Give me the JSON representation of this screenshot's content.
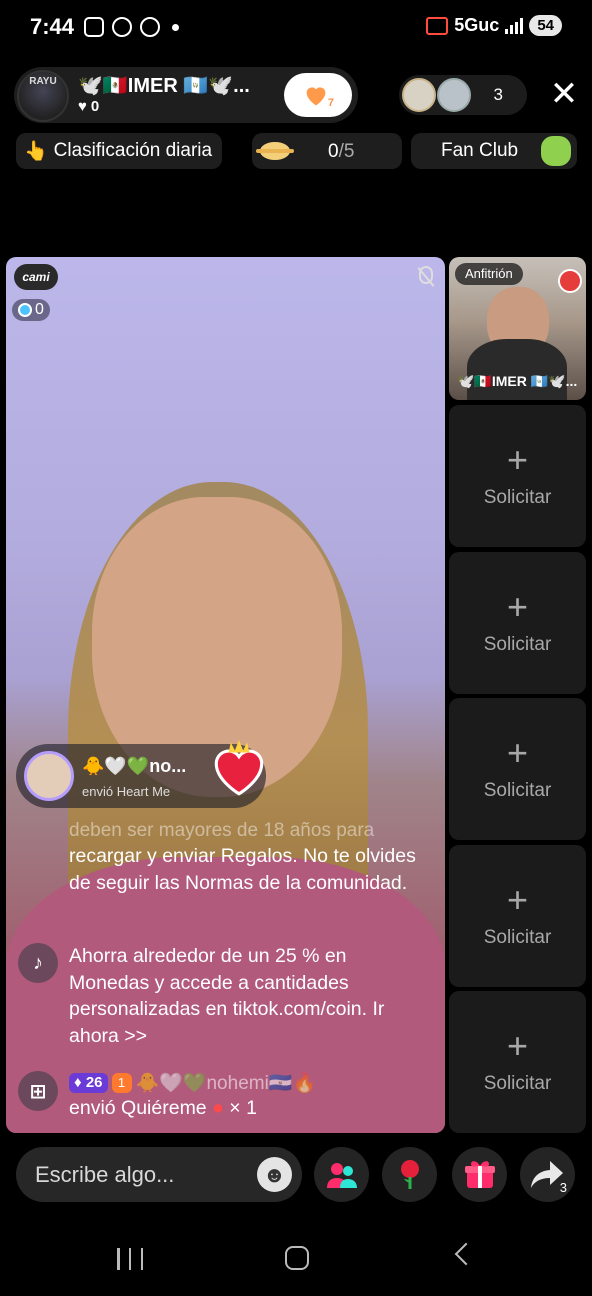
{
  "status_bar": {
    "time": "7:44",
    "network": "5Guc",
    "battery": "54"
  },
  "host": {
    "avatar_text": "RAYU",
    "name": "🕊️🇲🇽IMER 🇬🇹🕊️...",
    "likes": "0",
    "follow_count": "7"
  },
  "viewers": {
    "count": "3"
  },
  "badges": {
    "ranking": "Clasificación diaria",
    "planet_current": "0",
    "planet_total": "/5",
    "fan_club": "Fan Club"
  },
  "guest": {
    "badge": "cami",
    "score": "0"
  },
  "gift_toast": {
    "name": "🐥🤍💚no...",
    "message": "envió Heart Me"
  },
  "chat": {
    "faded_line": "deben ser mayores de 18 años para",
    "notice": "recargar y enviar Regalos. No te olvides de seguir las Normas de la comunidad.",
    "promo": "Ahorra alrededor de un 25 % en Monedas y accede a cantidades personalizadas en tiktok.com/coin. Ir ahora >>",
    "gift_user_level": "26",
    "gift_user_fan_level": "1",
    "gift_user_name": "🐥🤍💚nohemi🇸🇻🔥",
    "gift_message": "envió Quiéreme",
    "gift_count": "× 1"
  },
  "side_panel": {
    "host_label": "Anfitrión",
    "host_name": "🕊️🇲🇽IMER 🇬🇹🕊️...",
    "slots": [
      {
        "label": "Solicitar"
      },
      {
        "label": "Solicitar"
      },
      {
        "label": "Solicitar"
      },
      {
        "label": "Solicitar"
      },
      {
        "label": "Solicitar"
      }
    ]
  },
  "bottom_bar": {
    "input_placeholder": "Escribe algo...",
    "share_count": "3"
  },
  "icons": {
    "invite": "invite-guests-icon",
    "rose": "rose-icon",
    "gift": "gift-icon",
    "share": "share-icon"
  },
  "colors": {
    "accent_pink": "#ff2d6b",
    "accent_teal": "#2ee6d6",
    "follow_heart": "#ff9a4a"
  }
}
